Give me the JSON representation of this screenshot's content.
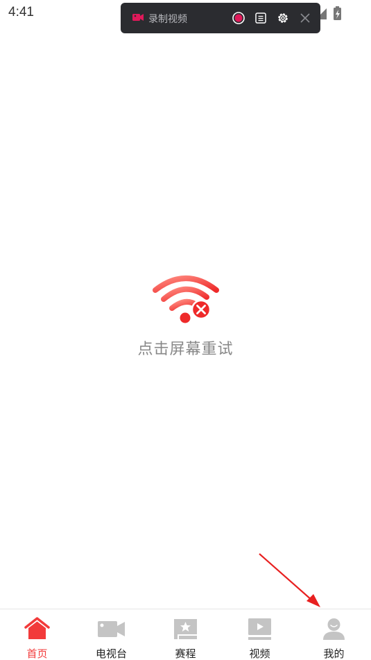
{
  "status_bar": {
    "time": "4:41"
  },
  "recorder": {
    "label": "录制视频",
    "icons": [
      "video-camera-icon",
      "record-icon",
      "list-icon",
      "settings-icon",
      "close-icon"
    ]
  },
  "error": {
    "icon": "wifi-off-icon",
    "message": "点击屏幕重试"
  },
  "bottom_nav": {
    "active_color": "#f23a3a",
    "items": [
      {
        "label": "首页",
        "icon": "home-icon",
        "active": true
      },
      {
        "label": "电视台",
        "icon": "video-camera-icon",
        "active": false
      },
      {
        "label": "赛程",
        "icon": "schedule-star-icon",
        "active": false
      },
      {
        "label": "视频",
        "icon": "play-icon",
        "active": false
      },
      {
        "label": "我的",
        "icon": "user-icon",
        "active": false
      }
    ]
  }
}
